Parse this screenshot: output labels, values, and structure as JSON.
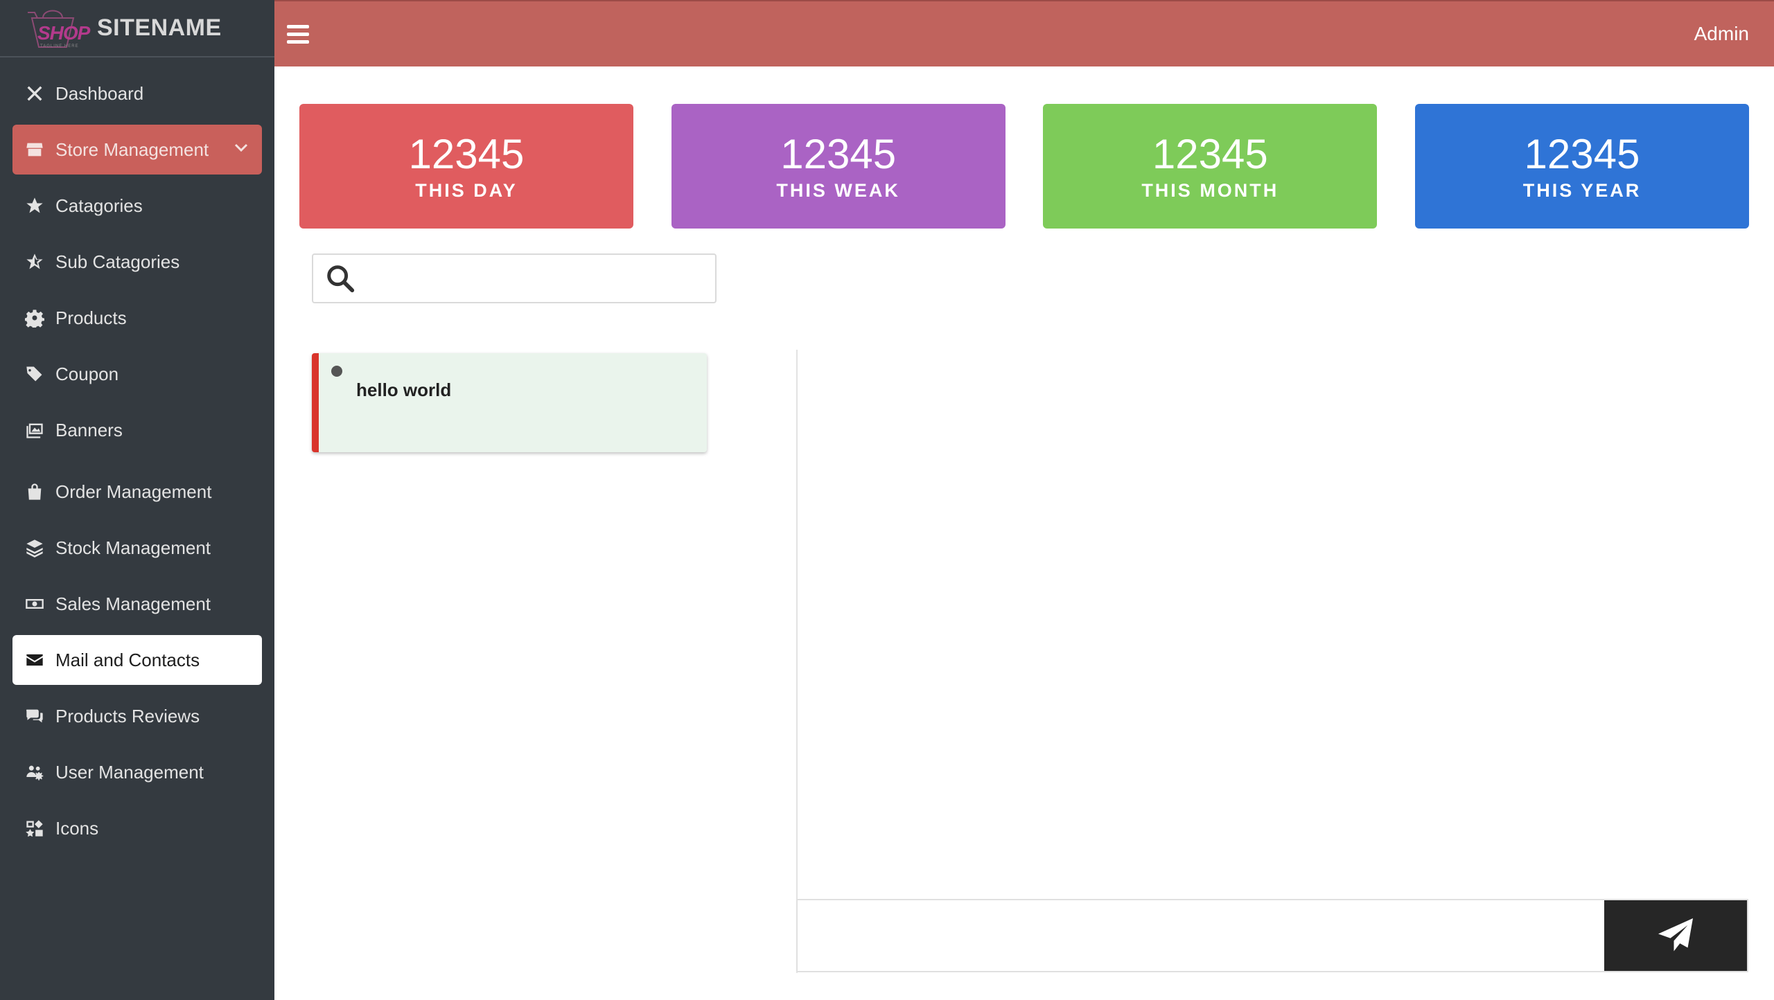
{
  "brand": {
    "logo_text": "SHOP",
    "logo_tagline": "TAGLINE HERE",
    "name": "SITENAME"
  },
  "topbar": {
    "menu_icon": "hamburger-icon",
    "user_label": "Admin"
  },
  "sidebar": {
    "items": [
      {
        "label": "Dashboard",
        "icon": "tools-icon"
      },
      {
        "label": "Store Management",
        "icon": "store-icon",
        "state": "expanded"
      },
      {
        "label": "Catagories",
        "icon": "star-icon"
      },
      {
        "label": "Sub Catagories",
        "icon": "star-half-icon"
      },
      {
        "label": "Products",
        "icon": "gear-icon"
      },
      {
        "label": "Coupon",
        "icon": "tags-icon"
      },
      {
        "label": "Banners",
        "icon": "images-icon"
      },
      {
        "label": "Order Management",
        "icon": "shopping-bag-icon"
      },
      {
        "label": "Stock Management",
        "icon": "layers-icon"
      },
      {
        "label": "Sales Management",
        "icon": "money-bill-icon"
      },
      {
        "label": "Mail and Contacts",
        "icon": "envelope-icon",
        "state": "selected"
      },
      {
        "label": "Products Reviews",
        "icon": "comments-icon"
      },
      {
        "label": "User Management",
        "icon": "users-gear-icon"
      },
      {
        "label": "Icons",
        "icon": "icons-icon"
      }
    ]
  },
  "stats": [
    {
      "value": "12345",
      "label": "THIS DAY",
      "color": "#e05c5f"
    },
    {
      "value": "12345",
      "label": "THIS WEAK",
      "color": "#aa63c4"
    },
    {
      "value": "12345",
      "label": "THIS MONTH",
      "color": "#7ecb59"
    },
    {
      "value": "12345",
      "label": "THIS YEAR",
      "color": "#2f74d6"
    }
  ],
  "search": {
    "placeholder": "",
    "value": ""
  },
  "messages": [
    {
      "text": "hello world",
      "status": "unread"
    }
  ],
  "compose": {
    "placeholder": "",
    "send_icon": "paper-plane-icon"
  },
  "colors": {
    "sidebar_bg": "#343a40",
    "topbar_bg": "#c0635d",
    "active_parent_bg": "#c9605b",
    "send_button_bg": "#262626"
  }
}
